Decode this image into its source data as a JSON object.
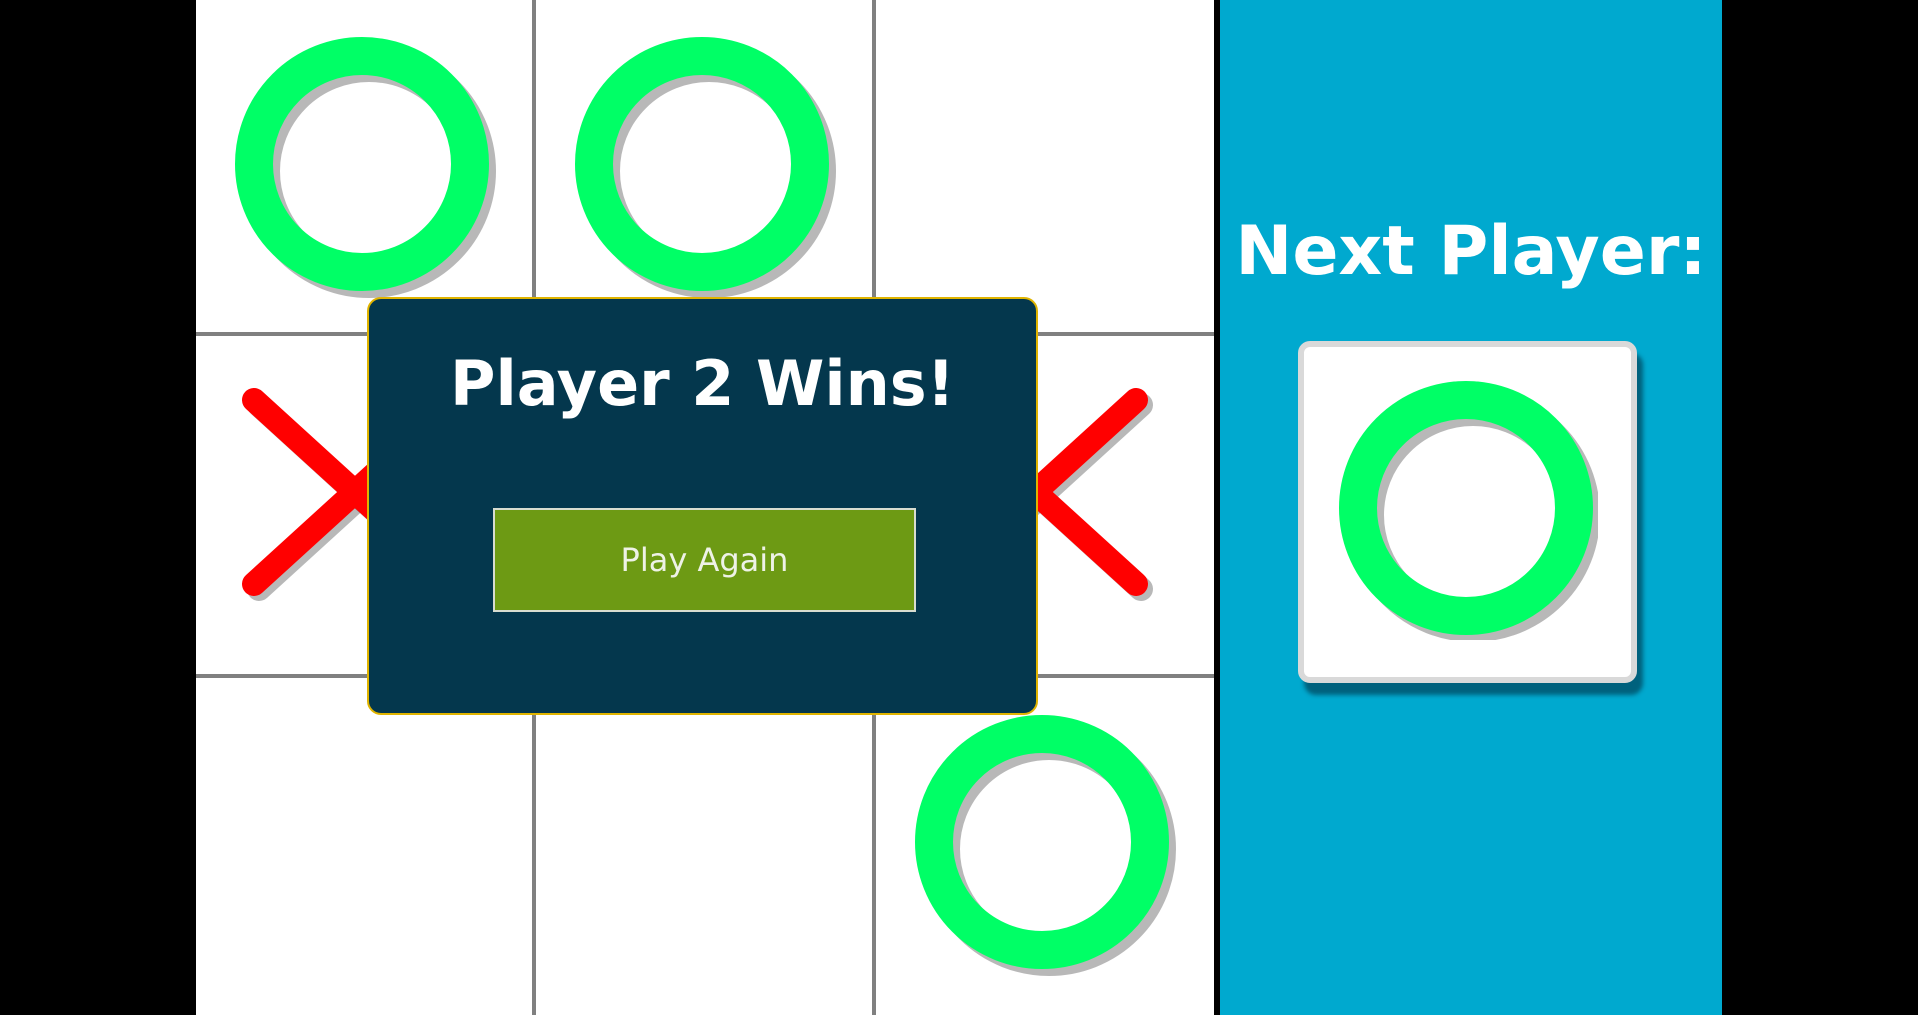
{
  "board": {
    "cells": [
      "O",
      "O",
      "",
      "X",
      "",
      "X",
      "",
      "",
      "O"
    ]
  },
  "sidebar": {
    "next_label": "Next Player:",
    "next_symbol": "O"
  },
  "modal": {
    "title": "Player 2 Wins!",
    "button_label": "Play Again"
  },
  "colors": {
    "o_mark": "#00ff66",
    "x_mark": "#ff0000",
    "sidebar_bg": "#00a9cf",
    "modal_bg": "#04374d",
    "modal_border": "#e0b400",
    "button_bg": "#6d9a14"
  }
}
